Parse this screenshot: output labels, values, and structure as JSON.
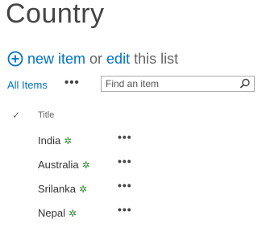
{
  "list": {
    "title": "Country"
  },
  "add_item": {
    "new_item_label": "new item",
    "or_text": "or",
    "edit_label": "edit",
    "this_list_text": "this list"
  },
  "views": {
    "all_items_label": "All Items",
    "more_label": "•••"
  },
  "search": {
    "placeholder": "Find an item"
  },
  "columns": {
    "title_header": "Title"
  },
  "items": [
    {
      "title": "India",
      "new_badge": "✲",
      "menu": "•••"
    },
    {
      "title": "Australia",
      "new_badge": "✲",
      "menu": "•••"
    },
    {
      "title": "Srilanka",
      "new_badge": "✲",
      "menu": "•••"
    },
    {
      "title": "Nepal",
      "new_badge": "✲",
      "menu": "•••"
    }
  ],
  "colors": {
    "link": "#0072c6",
    "new_badge": "#2e8b2e",
    "title_text": "#444444"
  },
  "icons": {
    "add": "plus-circle-icon",
    "search": "magnifier-icon",
    "select": "checkmark-icon",
    "new": "new-item-badge-icon"
  }
}
